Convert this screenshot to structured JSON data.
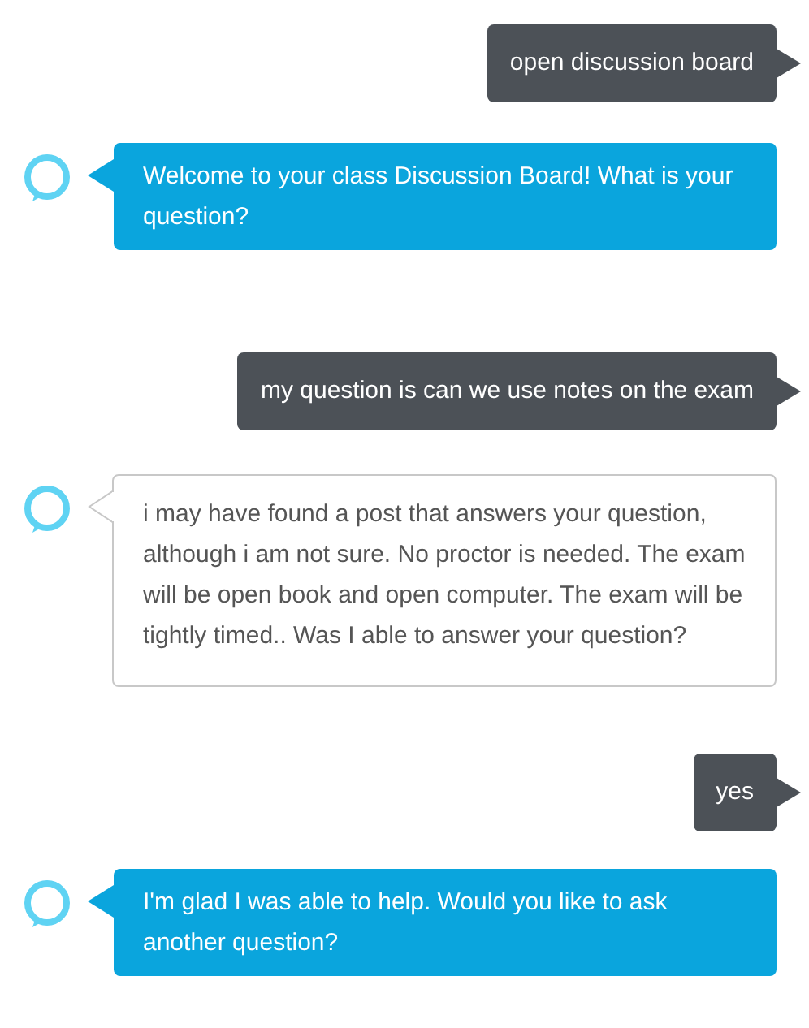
{
  "messages": [
    {
      "kind": "user",
      "text": "open discussion board"
    },
    {
      "kind": "assistant-highlight",
      "text": "Welcome to your class Discussion Board! What is your question?"
    },
    {
      "kind": "user",
      "text": "my question is can we use notes on the exam"
    },
    {
      "kind": "assistant-card",
      "text": "i may have found a post that answers your question, although i am not sure. No proctor is needed. The exam will be open book and open computer. The exam will be tightly timed.. Was I able to answer your question?"
    },
    {
      "kind": "user",
      "text": "yes"
    },
    {
      "kind": "assistant-highlight",
      "text": "I'm glad I was able to help. Would you like to ask another question?"
    }
  ]
}
